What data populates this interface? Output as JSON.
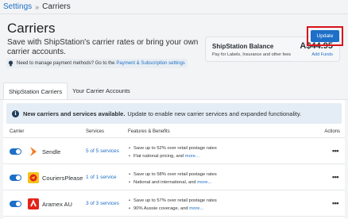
{
  "breadcrumb": {
    "root": "Settings",
    "separator": "»",
    "current": "Carriers"
  },
  "page": {
    "title": "Carriers",
    "subtitle": "Save with ShipStation's carrier rates or bring your own carrier accounts.",
    "notice_text": "Need to manage payment methods? Go to the",
    "notice_link": "Payment & Subscription settings"
  },
  "balance": {
    "label": "ShipStation Balance",
    "amount": "A$44.95",
    "note": "Pay for Labels, Insurance and other fees",
    "add_funds": "Add Funds"
  },
  "tabs": [
    {
      "label": "ShipStation Carriers",
      "active": true
    },
    {
      "label": "Your Carrier Accounts",
      "active": false
    }
  ],
  "banner": {
    "bold": "New carriers and services available.",
    "text": "Update to enable new carrier services and expanded functionality.",
    "button": "Update"
  },
  "table": {
    "headers": {
      "carrier": "Carrier",
      "services": "Services",
      "features": "Features & Benefits",
      "actions": "Actions"
    },
    "rows": [
      {
        "name": "Sendle",
        "services": "5 of 5 services",
        "f1": "Save up to 52% over retail postage rates",
        "f2": "Flat national pricing, and",
        "more": "more...",
        "logo_icon": "sendle-logo-icon",
        "logo_color": "#f47b20"
      },
      {
        "name": "CouriersPlease",
        "services": "1 of 1 service",
        "f1": "Save up to 58% over retail postage rates",
        "f2": "National and international, and",
        "more": "more...",
        "logo_icon": "couriersplease-logo-icon",
        "logo_color": "#e2231a"
      },
      {
        "name": "Aramex AU",
        "services": "3 of 3 services",
        "f1": "Save up to 57% over retail postage rates",
        "f2": "90% Aussie coverage, and",
        "more": "more...",
        "logo_icon": "aramex-logo-icon",
        "logo_color": "#e2231a"
      }
    ]
  },
  "colors": {
    "accent": "#1d6fc7",
    "highlight_border": "#d9121b",
    "banner_bg": "#e4edf5"
  }
}
